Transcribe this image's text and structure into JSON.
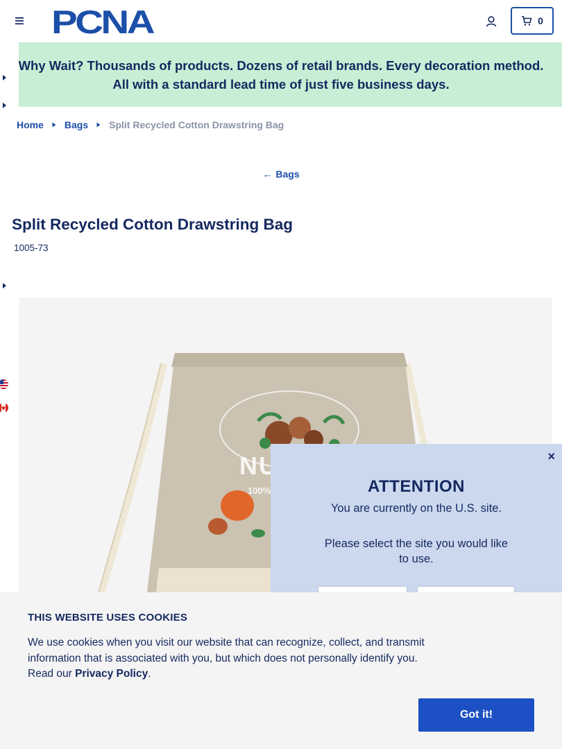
{
  "header": {
    "logo_text": "PCNA",
    "cart_count": "0"
  },
  "promo": {
    "text": "Why Wait? Thousands of products. Dozens of retail brands. Every decoration method. All with a standard lead time of just five business days."
  },
  "breadcrumb": {
    "items": [
      "Home",
      "Bags",
      "Split Recycled Cotton Drawstring Bag"
    ]
  },
  "back_link": {
    "label": "Bags"
  },
  "product": {
    "title": "Split Recycled Cotton Drawstring Bag",
    "sku": "1005-73",
    "image_print": "NUTO",
    "image_print_sub": "100%"
  },
  "site_modal": {
    "title": "ATTENTION",
    "message": "You are currently on the U.S. site.",
    "prompt": "Please select the site you would like to use.",
    "close": "×"
  },
  "cookie_banner": {
    "title": "THIS WEBSITE USES COOKIES",
    "text_before": "We use cookies when you visit our website that can recognize, collect, and transmit information that is associated with you, but which does not personally identify you. Read our ",
    "link": "Privacy Policy",
    "text_after": ".",
    "button": "Got it!"
  },
  "icons": {
    "menu": "hamburger-icon",
    "account": "user-icon",
    "cart": "cart-icon",
    "flags": [
      "us-flag-icon",
      "canada-flag-icon"
    ]
  },
  "colors": {
    "brand": "#1c4fa8",
    "navy": "#14285f",
    "promo_bg": "#c8eed5",
    "modal_bg": "#cbd8ee",
    "button": "#1c50c4"
  }
}
